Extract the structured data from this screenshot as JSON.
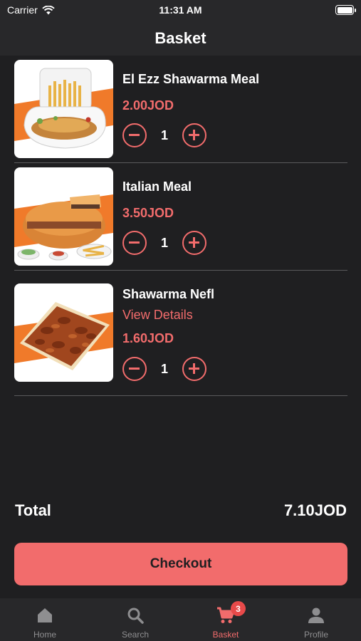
{
  "status": {
    "carrier": "Carrier",
    "time": "11:31 AM"
  },
  "header": {
    "title": "Basket"
  },
  "items": [
    {
      "name": "El Ezz Shawarma Meal",
      "price": "2.00JOD",
      "quantity": "1"
    },
    {
      "name": "Italian Meal",
      "price": "3.50JOD",
      "quantity": "1"
    },
    {
      "name": "Shawarma Nefl",
      "link": "View Details",
      "price": "1.60JOD",
      "quantity": "1"
    }
  ],
  "summary": {
    "total_label": "Total",
    "total_value": "7.10JOD"
  },
  "checkout": {
    "label": "Checkout"
  },
  "tabs": [
    {
      "label": "Home",
      "icon": "home-icon"
    },
    {
      "label": "Search",
      "icon": "search-icon"
    },
    {
      "label": "Basket",
      "icon": "cart-icon",
      "badge": "3"
    },
    {
      "label": "Profile",
      "icon": "person-icon"
    }
  ],
  "colors": {
    "background": "#1f1f21",
    "bar": "#28282a",
    "accent": "#f26c6c",
    "inactive": "#8e8e90",
    "badge": "#e84a4a"
  }
}
